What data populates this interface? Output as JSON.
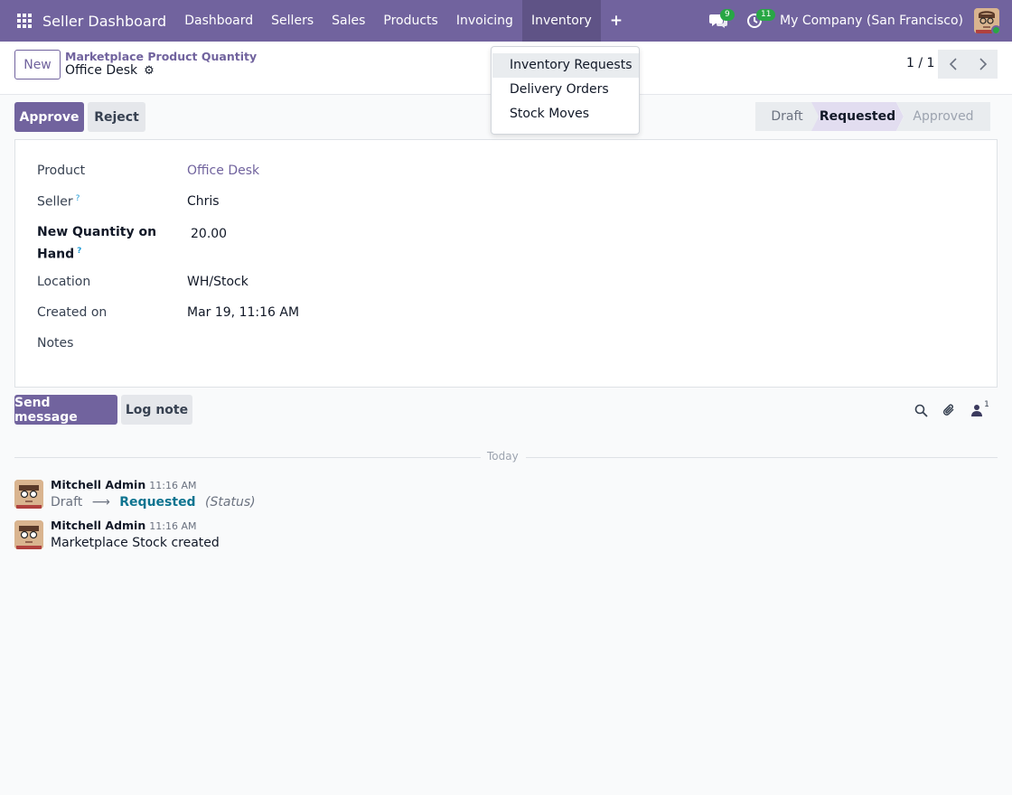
{
  "navbar": {
    "brand": "Seller Dashboard",
    "menu": [
      "Dashboard",
      "Sellers",
      "Sales",
      "Products",
      "Invoicing",
      "Inventory"
    ],
    "plus": "+",
    "messages_count": "9",
    "activities_count": "11",
    "company": "My Company (San Francisco)"
  },
  "control": {
    "new_label": "New",
    "breadcrumb": "Marketplace Product Quantity",
    "record_title": "Office Desk",
    "pager": "1 / 1"
  },
  "actions": {
    "approve": "Approve",
    "reject": "Reject"
  },
  "statusbar": {
    "stages": [
      "Draft",
      "Requested",
      "Approved"
    ],
    "current": "Requested"
  },
  "form": {
    "product_label": "Product",
    "product_value": "Office Desk",
    "seller_label": "Seller",
    "seller_value": "Chris",
    "qty_label_line1": "New Quantity on",
    "qty_label_line2": "Hand",
    "qty_value": "20.00",
    "location_label": "Location",
    "location_value": "WH/Stock",
    "created_label": "Created on",
    "created_value": "Mar 19, 11:16 AM",
    "notes_label": "Notes",
    "help_mark": "?"
  },
  "chatter": {
    "send_message": "Send message",
    "log_note": "Log note",
    "followers_count": "1",
    "separator": "Today",
    "messages": [
      {
        "author": "Mitchell Admin",
        "time": "11:16 AM",
        "old_value": "Draft",
        "new_value": "Requested",
        "field": "(Status)"
      },
      {
        "author": "Mitchell Admin",
        "time": "11:16 AM",
        "body": "Marketplace Stock created"
      }
    ]
  },
  "dropdown": {
    "items": [
      "Inventory Requests",
      "Delivery Orders",
      "Stock Moves"
    ],
    "highlighted": "Inventory Requests"
  },
  "colors": {
    "brand": "#71639e",
    "badge": "#28a745",
    "tracking_new": "#0e7490"
  }
}
